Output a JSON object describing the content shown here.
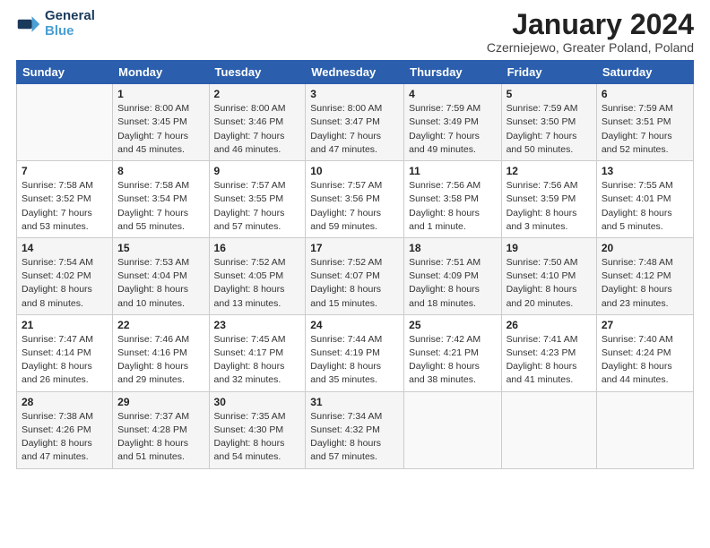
{
  "logo": {
    "line1": "General",
    "line2": "Blue"
  },
  "title": "January 2024",
  "subtitle": "Czerniejewo, Greater Poland, Poland",
  "days_header": [
    "Sunday",
    "Monday",
    "Tuesday",
    "Wednesday",
    "Thursday",
    "Friday",
    "Saturday"
  ],
  "weeks": [
    [
      {
        "num": "",
        "sunrise": "",
        "sunset": "",
        "daylight": ""
      },
      {
        "num": "1",
        "sunrise": "Sunrise: 8:00 AM",
        "sunset": "Sunset: 3:45 PM",
        "daylight": "Daylight: 7 hours and 45 minutes."
      },
      {
        "num": "2",
        "sunrise": "Sunrise: 8:00 AM",
        "sunset": "Sunset: 3:46 PM",
        "daylight": "Daylight: 7 hours and 46 minutes."
      },
      {
        "num": "3",
        "sunrise": "Sunrise: 8:00 AM",
        "sunset": "Sunset: 3:47 PM",
        "daylight": "Daylight: 7 hours and 47 minutes."
      },
      {
        "num": "4",
        "sunrise": "Sunrise: 7:59 AM",
        "sunset": "Sunset: 3:49 PM",
        "daylight": "Daylight: 7 hours and 49 minutes."
      },
      {
        "num": "5",
        "sunrise": "Sunrise: 7:59 AM",
        "sunset": "Sunset: 3:50 PM",
        "daylight": "Daylight: 7 hours and 50 minutes."
      },
      {
        "num": "6",
        "sunrise": "Sunrise: 7:59 AM",
        "sunset": "Sunset: 3:51 PM",
        "daylight": "Daylight: 7 hours and 52 minutes."
      }
    ],
    [
      {
        "num": "7",
        "sunrise": "Sunrise: 7:58 AM",
        "sunset": "Sunset: 3:52 PM",
        "daylight": "Daylight: 7 hours and 53 minutes."
      },
      {
        "num": "8",
        "sunrise": "Sunrise: 7:58 AM",
        "sunset": "Sunset: 3:54 PM",
        "daylight": "Daylight: 7 hours and 55 minutes."
      },
      {
        "num": "9",
        "sunrise": "Sunrise: 7:57 AM",
        "sunset": "Sunset: 3:55 PM",
        "daylight": "Daylight: 7 hours and 57 minutes."
      },
      {
        "num": "10",
        "sunrise": "Sunrise: 7:57 AM",
        "sunset": "Sunset: 3:56 PM",
        "daylight": "Daylight: 7 hours and 59 minutes."
      },
      {
        "num": "11",
        "sunrise": "Sunrise: 7:56 AM",
        "sunset": "Sunset: 3:58 PM",
        "daylight": "Daylight: 8 hours and 1 minute."
      },
      {
        "num": "12",
        "sunrise": "Sunrise: 7:56 AM",
        "sunset": "Sunset: 3:59 PM",
        "daylight": "Daylight: 8 hours and 3 minutes."
      },
      {
        "num": "13",
        "sunrise": "Sunrise: 7:55 AM",
        "sunset": "Sunset: 4:01 PM",
        "daylight": "Daylight: 8 hours and 5 minutes."
      }
    ],
    [
      {
        "num": "14",
        "sunrise": "Sunrise: 7:54 AM",
        "sunset": "Sunset: 4:02 PM",
        "daylight": "Daylight: 8 hours and 8 minutes."
      },
      {
        "num": "15",
        "sunrise": "Sunrise: 7:53 AM",
        "sunset": "Sunset: 4:04 PM",
        "daylight": "Daylight: 8 hours and 10 minutes."
      },
      {
        "num": "16",
        "sunrise": "Sunrise: 7:52 AM",
        "sunset": "Sunset: 4:05 PM",
        "daylight": "Daylight: 8 hours and 13 minutes."
      },
      {
        "num": "17",
        "sunrise": "Sunrise: 7:52 AM",
        "sunset": "Sunset: 4:07 PM",
        "daylight": "Daylight: 8 hours and 15 minutes."
      },
      {
        "num": "18",
        "sunrise": "Sunrise: 7:51 AM",
        "sunset": "Sunset: 4:09 PM",
        "daylight": "Daylight: 8 hours and 18 minutes."
      },
      {
        "num": "19",
        "sunrise": "Sunrise: 7:50 AM",
        "sunset": "Sunset: 4:10 PM",
        "daylight": "Daylight: 8 hours and 20 minutes."
      },
      {
        "num": "20",
        "sunrise": "Sunrise: 7:48 AM",
        "sunset": "Sunset: 4:12 PM",
        "daylight": "Daylight: 8 hours and 23 minutes."
      }
    ],
    [
      {
        "num": "21",
        "sunrise": "Sunrise: 7:47 AM",
        "sunset": "Sunset: 4:14 PM",
        "daylight": "Daylight: 8 hours and 26 minutes."
      },
      {
        "num": "22",
        "sunrise": "Sunrise: 7:46 AM",
        "sunset": "Sunset: 4:16 PM",
        "daylight": "Daylight: 8 hours and 29 minutes."
      },
      {
        "num": "23",
        "sunrise": "Sunrise: 7:45 AM",
        "sunset": "Sunset: 4:17 PM",
        "daylight": "Daylight: 8 hours and 32 minutes."
      },
      {
        "num": "24",
        "sunrise": "Sunrise: 7:44 AM",
        "sunset": "Sunset: 4:19 PM",
        "daylight": "Daylight: 8 hours and 35 minutes."
      },
      {
        "num": "25",
        "sunrise": "Sunrise: 7:42 AM",
        "sunset": "Sunset: 4:21 PM",
        "daylight": "Daylight: 8 hours and 38 minutes."
      },
      {
        "num": "26",
        "sunrise": "Sunrise: 7:41 AM",
        "sunset": "Sunset: 4:23 PM",
        "daylight": "Daylight: 8 hours and 41 minutes."
      },
      {
        "num": "27",
        "sunrise": "Sunrise: 7:40 AM",
        "sunset": "Sunset: 4:24 PM",
        "daylight": "Daylight: 8 hours and 44 minutes."
      }
    ],
    [
      {
        "num": "28",
        "sunrise": "Sunrise: 7:38 AM",
        "sunset": "Sunset: 4:26 PM",
        "daylight": "Daylight: 8 hours and 47 minutes."
      },
      {
        "num": "29",
        "sunrise": "Sunrise: 7:37 AM",
        "sunset": "Sunset: 4:28 PM",
        "daylight": "Daylight: 8 hours and 51 minutes."
      },
      {
        "num": "30",
        "sunrise": "Sunrise: 7:35 AM",
        "sunset": "Sunset: 4:30 PM",
        "daylight": "Daylight: 8 hours and 54 minutes."
      },
      {
        "num": "31",
        "sunrise": "Sunrise: 7:34 AM",
        "sunset": "Sunset: 4:32 PM",
        "daylight": "Daylight: 8 hours and 57 minutes."
      },
      {
        "num": "",
        "sunrise": "",
        "sunset": "",
        "daylight": ""
      },
      {
        "num": "",
        "sunrise": "",
        "sunset": "",
        "daylight": ""
      },
      {
        "num": "",
        "sunrise": "",
        "sunset": "",
        "daylight": ""
      }
    ]
  ]
}
